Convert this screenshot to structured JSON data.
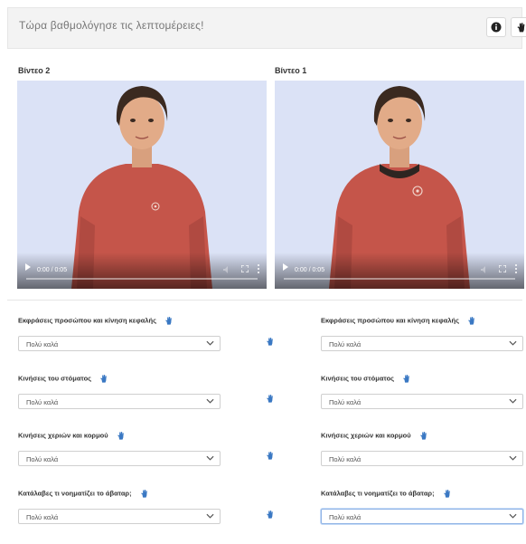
{
  "header": {
    "title": "Τώρα βαθμολόγησε τις λεπτομέρειες!",
    "info_icon": "info-icon",
    "help_icon": "hand-sign-icon"
  },
  "videos": [
    {
      "label": "Βίντεο 2",
      "time": "0:00 / 0:05"
    },
    {
      "label": "Βίντεο 1",
      "time": "0:00 / 0:05"
    }
  ],
  "questions": [
    {
      "label": "Εκφράσεις προσώπου και κίνηση κεφαλής",
      "left_value": "Πολύ καλά",
      "right_value": "Πολύ καλά"
    },
    {
      "label": "Κινήσεις του στόματος",
      "left_value": "Πολύ καλά",
      "right_value": "Πολύ καλά"
    },
    {
      "label": "Κινήσεις χεριών και κορμού",
      "left_value": "Πολύ καλά",
      "right_value": "Πολύ καλά"
    },
    {
      "label": "Κατάλαβες τι νοηματίζει το άβαταρ;",
      "left_value": "Πολύ καλά",
      "right_value": "Πολύ καλά"
    }
  ],
  "colors": {
    "accent_hand": "#3a78c3",
    "sweater": "#c9574a",
    "video_bg": "#d9e0f5"
  }
}
